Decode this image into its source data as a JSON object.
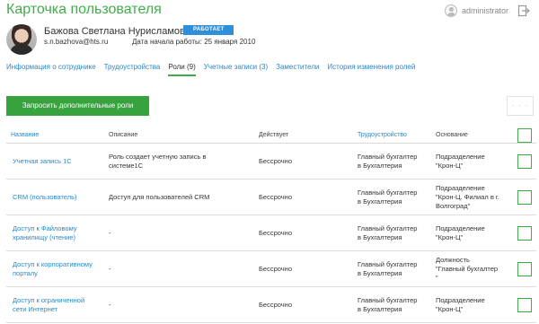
{
  "header": {
    "title": "Карточка пользователя",
    "username": "administrator",
    "icons": [
      "user-icon",
      "logout-icon"
    ]
  },
  "profile": {
    "full_name": "Бажова Светлана Нурисламовна",
    "status": "РАБОТАЕТ",
    "email": "s.n.bazhova@hts.ru",
    "start_date_label": "Дата начала работы: 25 января 2010"
  },
  "tabs": [
    {
      "label": "Информация о сотруднике"
    },
    {
      "label": "Трудоустройства"
    },
    {
      "label": "Роли (9)",
      "active": true
    },
    {
      "label": "Учетные записи (3)"
    },
    {
      "label": "Заместители"
    },
    {
      "label": "История изменения ролей"
    }
  ],
  "actions": {
    "request_label": "Запросить дополнительные роли",
    "more_label": "· · ·"
  },
  "table": {
    "columns": {
      "name": "Название",
      "description": "Описание",
      "valid": "Действует",
      "employment": "Трудоустройство",
      "basis": "Основание"
    },
    "rows": [
      {
        "name": [
          "Учетная запись 1С"
        ],
        "description": [
          "Роль создает учетную запись в",
          "системе1С"
        ],
        "valid": "Бессрочно",
        "employment": [
          "Главный бухгалтер",
          "в Бухгалтерия"
        ],
        "basis": [
          "Подразделение",
          "\"Крон-Ц\""
        ]
      },
      {
        "name": [
          "CRM (пользователь)"
        ],
        "description": [
          "Доступ для пользователей CRM"
        ],
        "valid": "Бессрочно",
        "employment": [
          "Главный бухгалтер",
          "в Бухгалтерия"
        ],
        "basis": [
          "Подразделение",
          "\"Крон-Ц. Филиал в г.",
          "Волгоград\""
        ]
      },
      {
        "name": [
          "Доступ к Файловому",
          "хранилищу (чтение)"
        ],
        "description": [
          "-"
        ],
        "valid": "Бессрочно",
        "employment": [
          "Главный бухгалтер",
          "в Бухгалтерия"
        ],
        "basis": [
          "Подразделение",
          "\"Крон-Ц\""
        ]
      },
      {
        "name": [
          "Доступ к корпоративному",
          "порталу"
        ],
        "description": [
          "-"
        ],
        "valid": "Бессрочно",
        "employment": [
          "Главный бухгалтер",
          "в Бухгалтерия"
        ],
        "basis": [
          "Должность",
          "\"Главный бухгалтер",
          "\""
        ]
      },
      {
        "name": [
          "Доступ к ограниченной",
          "сети Интернет"
        ],
        "description": [
          "-"
        ],
        "valid": "Бессрочно",
        "employment": [
          "Главный бухгалтер",
          "в Бухгалтерия"
        ],
        "basis": [
          "Подразделение",
          "\"Крон-Ц\""
        ]
      }
    ]
  },
  "colors": {
    "accent_green": "#3fae49",
    "link_blue": "#2a88c7",
    "badge_blue": "#2f8fd8"
  }
}
